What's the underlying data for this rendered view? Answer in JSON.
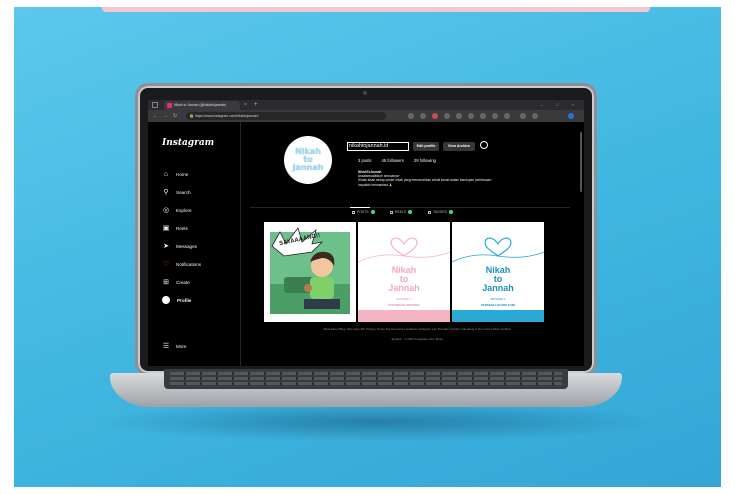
{
  "browser": {
    "tab_title": "Nikah to Jannah (@nikahtojannah)",
    "tab_close": "×",
    "new_tab": "+",
    "window_controls": "– □ ×",
    "url": "https://www.instagram.com/nikahtojannah/",
    "nav_icons": [
      "back-icon",
      "forward-icon",
      "reload-icon"
    ]
  },
  "instagram": {
    "logo": "Instagram",
    "nav": [
      {
        "label": "Home",
        "icon": "home-icon"
      },
      {
        "label": "Search",
        "icon": "search-icon"
      },
      {
        "label": "Explore",
        "icon": "explore-icon"
      },
      {
        "label": "Reels",
        "icon": "reels-icon"
      },
      {
        "label": "Messages",
        "icon": "messages-icon"
      },
      {
        "label": "Notifications",
        "icon": "heart-icon"
      },
      {
        "label": "Create",
        "icon": "create-icon"
      },
      {
        "label": "Profile",
        "icon": "avatar"
      },
      {
        "label": "More",
        "icon": "menu-icon"
      }
    ],
    "profile": {
      "logo_text": [
        "Nikah",
        "to",
        "Jannah"
      ],
      "username": "nikahtojannah.id",
      "edit_button": "Edit profile",
      "archive_button": "View Archive",
      "posts": "3 posts",
      "followers": "45 followers",
      "following": "29 following",
      "bio_name": "NikahToJannah",
      "bio_line1": "Assalamualaikum semuanya~",
      "bio_line2": "Simak kisah sedap poster nikah yang mencerahkan sekali kesah dalam bandupan pembaruan~",
      "bio_line3": "Insyallah bermanfaat 🙏"
    },
    "tabs": [
      {
        "label": "POSTS"
      },
      {
        "label": "REELS"
      },
      {
        "label": "TAGGED"
      }
    ],
    "posts": [
      {
        "caption": "SAYAAAANG!!"
      },
      {
        "title": [
          "Nikah",
          "to",
          "Jannah"
        ],
        "subtitle": "EPISODE 1",
        "band": "POSTINGAN PERTAMA"
      },
      {
        "title": [
          "Nikah",
          "to",
          "Jannah"
        ],
        "subtitle": "EPISODE 1",
        "band": "PERKENALAN DIRI KAMI"
      }
    ],
    "footer_links": "Meta  About  Blog  Jobs  Help  API  Privacy  Terms  Top Accounts  Locations  Instagram Lite  Threads  Contact Uploading & Non-Users  Meta Verified",
    "footer_copy": "English  ·  © 2023 Instagram from Meta"
  },
  "colors": {
    "background": "#3fb6e0",
    "pink": "#f4b4c4",
    "teal": "#29a9d3"
  }
}
